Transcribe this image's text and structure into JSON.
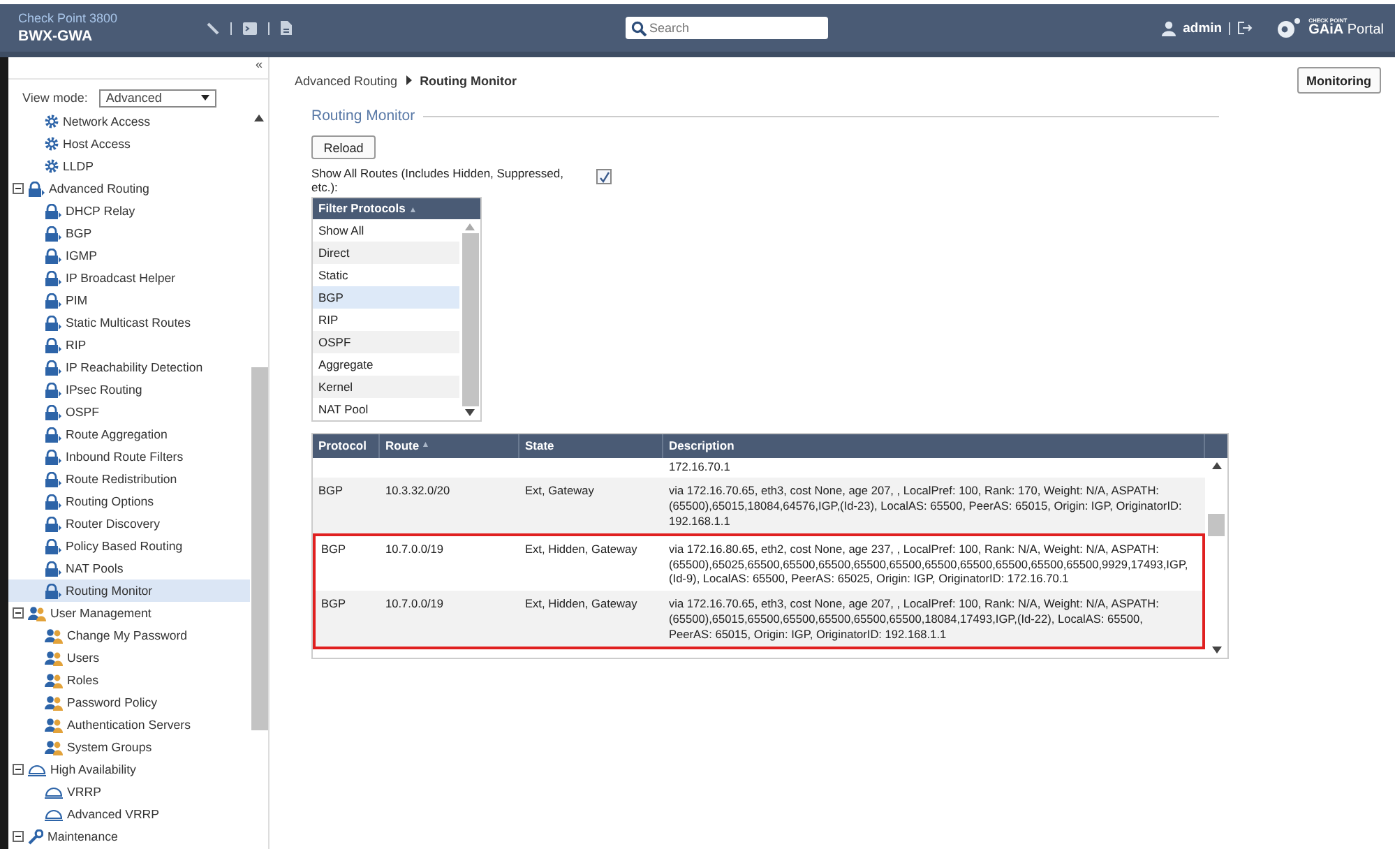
{
  "header": {
    "product": "Check Point 3800",
    "hostname": "BWX-GWA",
    "search": {
      "placeholder": "Search"
    },
    "user": "admin",
    "brand_small": "CHECK POINT",
    "brand": "GAiA",
    "brand_suffix": "Portal"
  },
  "sidebar": {
    "collapse": "«",
    "view_mode": {
      "label": "View mode:",
      "value": "Advanced"
    },
    "continued_items": {
      "kind": "gear",
      "items": [
        {
          "label": "Network Access",
          "selected": false
        },
        {
          "label": "Host Access",
          "selected": false
        },
        {
          "label": "LLDP",
          "selected": false
        }
      ]
    },
    "tree": [
      {
        "label": "Advanced Routing",
        "kind": "routing",
        "expanded": true,
        "children": [
          {
            "label": "DHCP Relay",
            "selected": false
          },
          {
            "label": "BGP",
            "selected": false
          },
          {
            "label": "IGMP",
            "selected": false
          },
          {
            "label": "IP Broadcast Helper",
            "selected": false
          },
          {
            "label": "PIM",
            "selected": false
          },
          {
            "label": "Static Multicast Routes",
            "selected": false
          },
          {
            "label": "RIP",
            "selected": false
          },
          {
            "label": "IP Reachability Detection",
            "selected": false
          },
          {
            "label": "IPsec Routing",
            "selected": false
          },
          {
            "label": "OSPF",
            "selected": false
          },
          {
            "label": "Route Aggregation",
            "selected": false
          },
          {
            "label": "Inbound Route Filters",
            "selected": false
          },
          {
            "label": "Route Redistribution",
            "selected": false
          },
          {
            "label": "Routing Options",
            "selected": false
          },
          {
            "label": "Router Discovery",
            "selected": false
          },
          {
            "label": "Policy Based Routing",
            "selected": false
          },
          {
            "label": "NAT Pools",
            "selected": false
          },
          {
            "label": "Routing Monitor",
            "selected": true
          }
        ]
      },
      {
        "label": "User Management",
        "kind": "users",
        "expanded": true,
        "children": [
          {
            "label": "Change My Password",
            "selected": false
          },
          {
            "label": "Users",
            "selected": false
          },
          {
            "label": "Roles",
            "selected": false
          },
          {
            "label": "Password Policy",
            "selected": false
          },
          {
            "label": "Authentication Servers",
            "selected": false
          },
          {
            "label": "System Groups",
            "selected": false
          }
        ]
      },
      {
        "label": "High Availability",
        "kind": "cloud",
        "expanded": true,
        "children": [
          {
            "label": "VRRP",
            "selected": false
          },
          {
            "label": "Advanced VRRP",
            "selected": false
          }
        ]
      },
      {
        "label": "Maintenance",
        "kind": "wrench",
        "expanded": true
      }
    ]
  },
  "breadcrumb": [
    "Advanced Routing",
    "Routing Monitor"
  ],
  "monitoring_button": "Monitoring",
  "section_title": "Routing Monitor",
  "reload_button": "Reload",
  "show_all": {
    "label": "Show All Routes (Includes Hidden, Suppressed, etc.):",
    "checked": true
  },
  "filter": {
    "title": "Filter Protocols",
    "sort": "▲",
    "options": [
      {
        "label": "Show All",
        "selected": false
      },
      {
        "label": "Direct",
        "selected": false
      },
      {
        "label": "Static",
        "selected": false
      },
      {
        "label": "BGP",
        "selected": true
      },
      {
        "label": "RIP",
        "selected": false
      },
      {
        "label": "OSPF",
        "selected": false
      },
      {
        "label": "Aggregate",
        "selected": false
      },
      {
        "label": "Kernel",
        "selected": false
      },
      {
        "label": "NAT Pool",
        "selected": false
      }
    ]
  },
  "table": {
    "columns": [
      {
        "label": "Protocol"
      },
      {
        "label": "Route",
        "sort": "▲"
      },
      {
        "label": "State"
      },
      {
        "label": "Description"
      }
    ],
    "rows": [
      {
        "description": "172.16.70.1",
        "highlighted": false
      },
      {
        "protocol": "BGP",
        "route": "10.3.32.0/20",
        "state": "Ext, Gateway",
        "description": "via 172.16.70.65, eth3, cost None, age 207, , LocalPref: 100, Rank: 170, Weight: N/A, ASPATH: (65500),65015,18084,64576,IGP,(Id-23), LocalAS: 65500, PeerAS: 65015, Origin: IGP, OriginatorID: 192.168.1.1",
        "highlighted": false
      },
      {
        "protocol": "BGP",
        "route": "10.7.0.0/19",
        "state": "Ext, Hidden, Gateway",
        "description": "via 172.16.80.65, eth2, cost None, age 237, , LocalPref: 100, Rank: N/A, Weight: N/A, ASPATH: (65500),65025,65500,65500,65500,65500,65500,65500,65500,65500,65500,65500,9929,17493,IGP,(Id-9), LocalAS: 65500, PeerAS: 65025, Origin: IGP, OriginatorID: 172.16.70.1",
        "highlighted": true
      },
      {
        "protocol": "BGP",
        "route": "10.7.0.0/19",
        "state": "Ext, Hidden, Gateway",
        "description": "via 172.16.70.65, eth3, cost None, age 207, , LocalPref: 100, Rank: N/A, Weight: N/A, ASPATH: (65500),65015,65500,65500,65500,65500,65500,18084,17493,IGP,(Id-22), LocalAS: 65500, PeerAS: 65015, Origin: IGP, OriginatorID: 192.168.1.1",
        "highlighted": true
      }
    ]
  }
}
